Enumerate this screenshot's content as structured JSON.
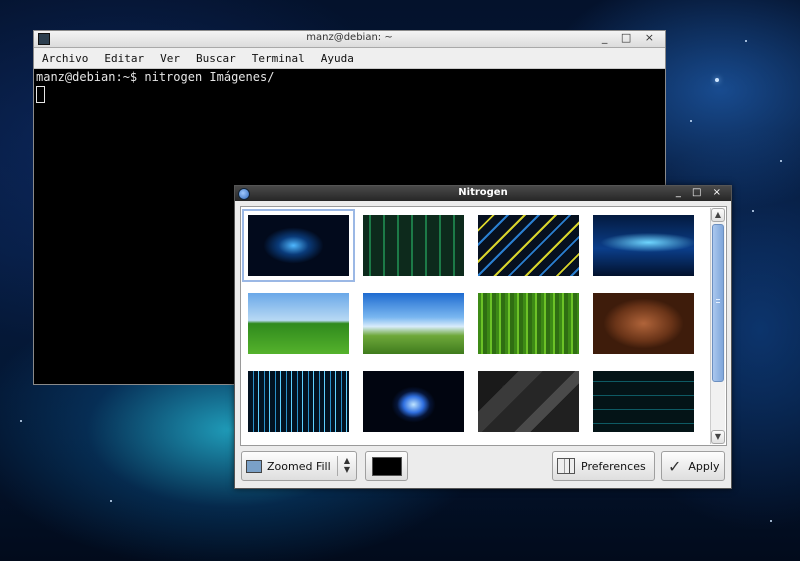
{
  "terminal": {
    "title": "manz@debian: ~",
    "window_buttons": "_ □ ×",
    "menu": [
      "Archivo",
      "Editar",
      "Ver",
      "Buscar",
      "Terminal",
      "Ayuda"
    ],
    "prompt_line": "manz@debian:~$ nitrogen Imágenes/"
  },
  "nitrogen": {
    "title": "Nitrogen",
    "window_buttons": "_ □ ×",
    "thumbnails": [
      {
        "name": "space-blue-nebula",
        "selected": true
      },
      {
        "name": "green-circuit-board"
      },
      {
        "name": "yellow-blue-neon-lines"
      },
      {
        "name": "blue-waves"
      },
      {
        "name": "green-field-trees"
      },
      {
        "name": "grass-blue-sky"
      },
      {
        "name": "green-light-streaks"
      },
      {
        "name": "brown-wood"
      },
      {
        "name": "blue-light-rain"
      },
      {
        "name": "blue-galaxy"
      },
      {
        "name": "dark-polygons"
      },
      {
        "name": "dark-teal-lines"
      }
    ],
    "mode_select": {
      "value": "Zoomed Fill",
      "icon": "image-mode-icon"
    },
    "color_button": {
      "color": "#000000"
    },
    "preferences_label": "Preferences",
    "apply_label": "Apply"
  },
  "colors": {
    "accent": "#7fa6da",
    "selection": "#c8d8f0"
  }
}
